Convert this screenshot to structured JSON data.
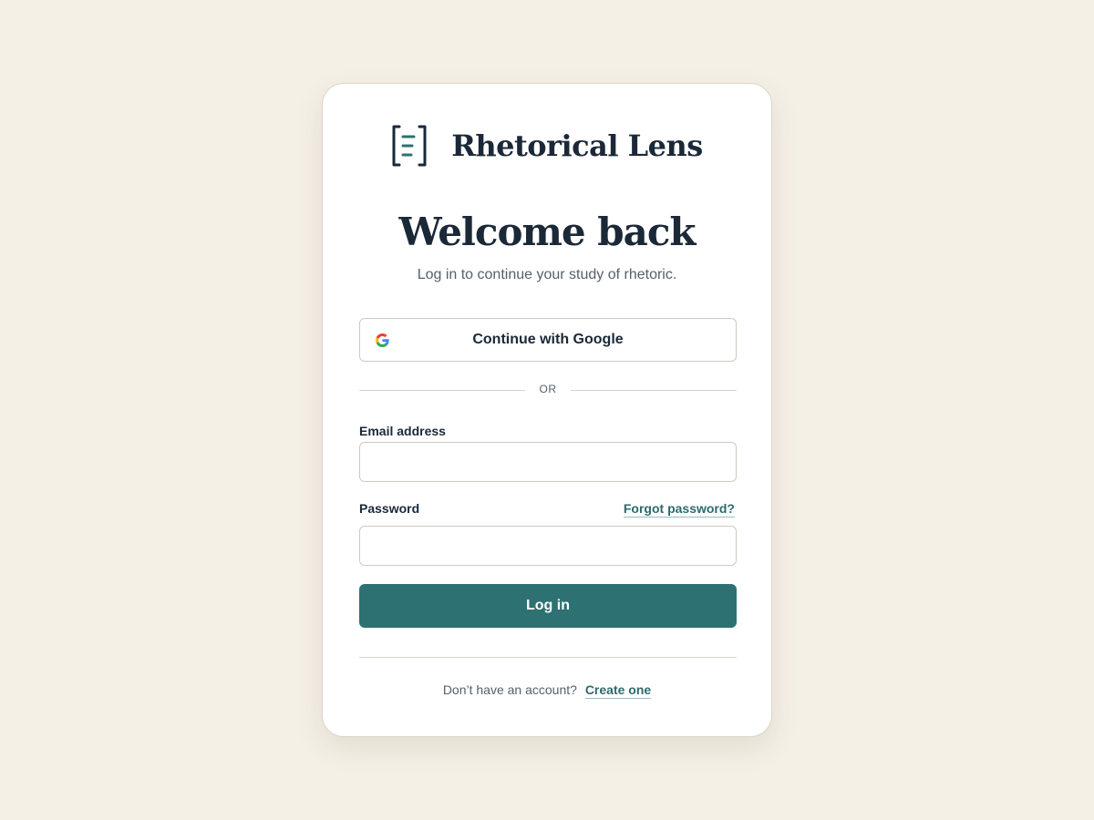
{
  "brand": {
    "name": "Rhetorical Lens",
    "icon": "document-bracket-icon"
  },
  "header": {
    "title": "Welcome back",
    "subtitle": "Log in to continue your study of rhetoric."
  },
  "sso": {
    "google_label": "Continue with Google",
    "icon": "google-g-icon"
  },
  "divider": {
    "label": "OR"
  },
  "form": {
    "email_label": "Email address",
    "email_value": "",
    "email_placeholder": "",
    "password_label": "Password",
    "password_value": "",
    "password_placeholder": "",
    "forgot_label": "Forgot password?",
    "submit_label": "Log in"
  },
  "footer": {
    "prompt": "Don’t have an account?",
    "link_label": "Create one"
  },
  "colors": {
    "background": "#f5f0e6",
    "card": "#ffffff",
    "primary": "#2e7172",
    "text": "#1b2838",
    "muted": "#55606e",
    "link": "#2e6a6b"
  }
}
